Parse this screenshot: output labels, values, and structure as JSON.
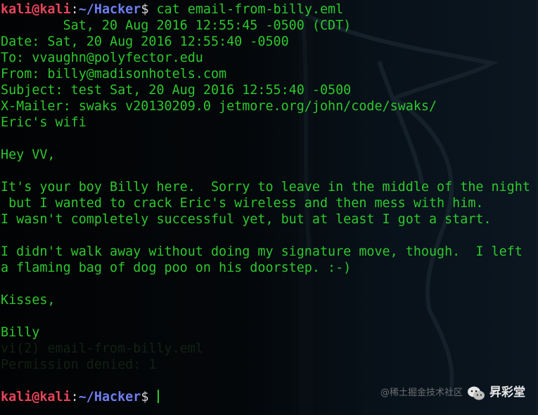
{
  "terminal": {
    "prompt": {
      "user": "kali@kali",
      "colon": ":",
      "path": "~/Hacker",
      "dollar": "$"
    },
    "command": " cat email-from-billy.eml",
    "output": [
      "        Sat, 20 Aug 2016 12:55:45 -0500 (CDT)",
      "Date: Sat, 20 Aug 2016 12:55:40 -0500",
      "To: vvaughn@polyfector.edu",
      "From: billy@madisonhotels.com",
      "Subject: test Sat, 20 Aug 2016 12:55:40 -0500",
      "X-Mailer: swaks v20130209.0 jetmore.org/john/code/swaks/",
      "Eric's wifi",
      "",
      "Hey VV,",
      "",
      "It's your boy Billy here.  Sorry to leave in the middle of the night",
      " but I wanted to crack Eric's wireless and then mess with him.",
      "I wasn't completely successful yet, but at least I got a start.",
      "",
      "I didn't walk away without doing my signature move, though.  I left",
      "a flaming bag of dog poo on his doorstep. :-)",
      "",
      "Kisses,",
      "",
      "Billy"
    ],
    "ghost_lines": [
      "vi(2) email-from-billy.eml",
      "Permission denied: 1"
    ]
  },
  "watermark": {
    "small_text": "@稀土掘金技术社区",
    "big_text": "昇彩堂",
    "icon": "wechat-icon"
  },
  "colors": {
    "text_green": "#2ec82e",
    "prompt_user": "#e8455a",
    "prompt_path": "#6f7ff0",
    "background": "#000000"
  }
}
